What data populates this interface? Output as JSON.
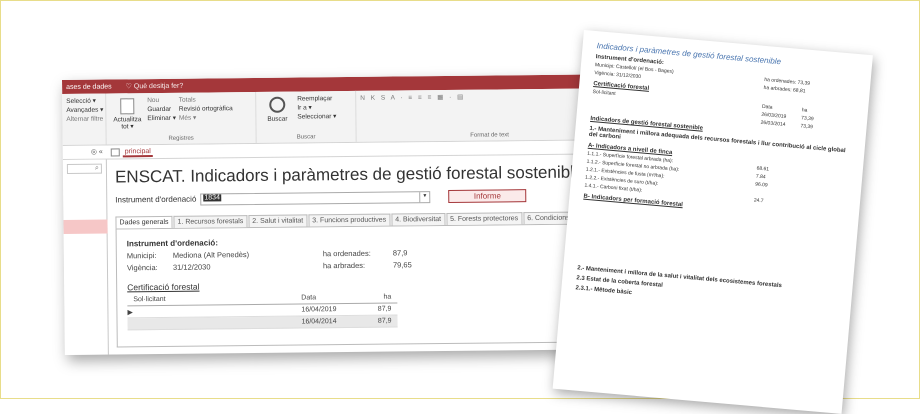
{
  "titlebar": {
    "left": "ases de dades",
    "tell_me": "Què desitja fer?"
  },
  "ribbon": {
    "g1": [
      "Selecció ▾",
      "Avançades ▾",
      "Alternar filtre"
    ],
    "g2_big": "Actualitza tot ▾",
    "g2": [
      "Nou",
      "Guardar",
      "Eliminar ▾"
    ],
    "g2b": [
      "Totals",
      "Revisió ortogràfica",
      "Més ▾"
    ],
    "g2_label": "Registres",
    "g3_big": "Buscar",
    "g3": [
      "Reemplaçar",
      "Ir a ▾",
      "Seleccionar ▾"
    ],
    "g3_label": "Buscar",
    "g4_label": "Format de text"
  },
  "nav": {
    "search_icon": "search-icon",
    "tab_label": "principal"
  },
  "form": {
    "title": "ENSCAT. Indicadors i paràmetres de gestió forestal sostenible",
    "instrument_label": "Instrument d'ordenació",
    "instrument_value": "1834",
    "report_button": "Informe",
    "tabs": [
      "Dades generals",
      "1. Recursos forestals",
      "2. Salut i vitalitat",
      "3. Funcions productives",
      "4. Biodiversitat",
      "5. Forests protectores",
      "6. Condicions"
    ],
    "section": "Instrument d'ordenació:",
    "municipi_label": "Municipi:",
    "municipi_value": "Mediona (Alt Penedès)",
    "vigencia_label": "Vigència:",
    "vigencia_value": "31/12/2030",
    "ha_ord_label": "ha ordenades:",
    "ha_ord_value": "87,9",
    "ha_arb_label": "ha arbrades:",
    "ha_arb_value": "79,65",
    "cert_title": "Certificació forestal",
    "grid_headers": [
      "Sol·licitant",
      "Data",
      "ha"
    ],
    "grid_rows": [
      [
        "",
        "16/04/2019",
        "87,9"
      ],
      [
        "",
        "16/04/2014",
        "87,9"
      ]
    ]
  },
  "paper": {
    "title": "Indicadors i paràmetres de gestió forestal sostenible",
    "inst": "Instrument d'ordenació:",
    "municipi": "Municipi:   Castellolí (el Bos - Bages)",
    "vigencia": "Vigència:   31/12/2030",
    "ha_ord": "ha ordenades:   73,39",
    "ha_arb": "ha arbrades:   68,81",
    "cert": "Certificació forestal",
    "sol": "Sol·licitant",
    "data": [
      "Data",
      "ha"
    ],
    "drows": [
      [
        "26/03/2019",
        "73,39"
      ],
      [
        "26/03/2014",
        "73,39"
      ]
    ],
    "ind": "Indicadors de gestió forestal sostenible",
    "h1": "1.- Manteniment i millora adequada dels recursos forestals i llur contribució al cicle global del carboni",
    "h1a": "A- Indicadors a nivell de finca",
    "l1": [
      [
        "1.1.1.- Superfície forestal arbrada (ha):",
        "68.61"
      ],
      [
        "1.1.2.- Superfície forestal no arbrada (ha):",
        "7.84"
      ],
      [
        "1.2.1.- Existències de fusta (m³/ha):",
        "96.09"
      ],
      [
        "1.2.2.- Existències de suro (t/ha):",
        ""
      ],
      [
        "1.4.1.- Carboni fixat (t/ha):",
        "24.7"
      ]
    ],
    "h1b": "B- Indicadors per formació forestal",
    "h2": "2.- Manteniment i millora de la salut i vitalitat dels ecosistemes forestals",
    "h2a": "2.3 Estat de la coberta forestal",
    "h2b": "2.3.1.- Mètode bàsic"
  }
}
